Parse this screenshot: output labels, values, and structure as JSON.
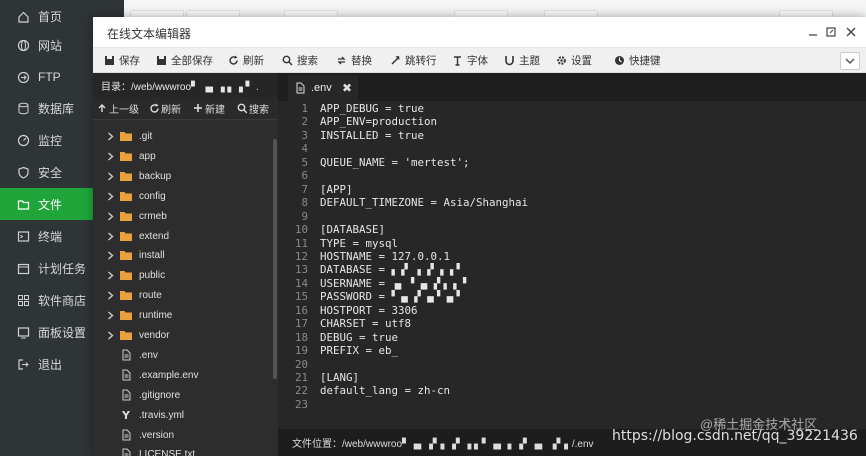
{
  "sidebar": {
    "items": [
      {
        "label": "首页",
        "icon": "home-icon"
      },
      {
        "label": "网站",
        "icon": "globe-icon"
      },
      {
        "label": "FTP",
        "icon": "ftp-icon"
      },
      {
        "label": "数据库",
        "icon": "database-icon"
      },
      {
        "label": "监控",
        "icon": "monitor-icon"
      },
      {
        "label": "安全",
        "icon": "shield-icon"
      },
      {
        "label": "文件",
        "icon": "folder-icon"
      },
      {
        "label": "终端",
        "icon": "terminal-icon"
      },
      {
        "label": "计划任务",
        "icon": "schedule-icon"
      },
      {
        "label": "软件商店",
        "icon": "store-icon"
      },
      {
        "label": "面板设置",
        "icon": "settings-icon"
      },
      {
        "label": "退出",
        "icon": "logout-icon"
      }
    ],
    "active_index": 6,
    "active_color": "#20a53a"
  },
  "window": {
    "title": "在线文本编辑器",
    "controls": [
      "minimize",
      "maximize",
      "close"
    ]
  },
  "toolbar": {
    "items": [
      {
        "label": "保存",
        "icon": "save-icon"
      },
      {
        "label": "全部保存",
        "icon": "save-all-icon"
      },
      {
        "label": "刷新",
        "icon": "refresh-icon"
      },
      {
        "label": "搜索",
        "icon": "search-icon"
      },
      {
        "label": "替换",
        "icon": "replace-icon"
      },
      {
        "label": "跳转行",
        "icon": "goto-line-icon"
      },
      {
        "label": "字体",
        "icon": "font-icon"
      },
      {
        "label": "主题",
        "icon": "theme-icon"
      },
      {
        "label": "设置",
        "icon": "gear-icon"
      },
      {
        "label": "快捷键",
        "icon": "shortcut-icon"
      }
    ]
  },
  "tree": {
    "dir_label": "目录：/web/wwwroo▘ ▗▖▗ ▖▗ ▘ .",
    "actions": [
      {
        "label": "上一级",
        "icon": "arrow-up-icon"
      },
      {
        "label": "刷新",
        "icon": "refresh-icon"
      },
      {
        "label": "新建",
        "icon": "plus-icon"
      },
      {
        "label": "搜索",
        "icon": "search-icon"
      }
    ],
    "folders": [
      ".git",
      "app",
      "backup",
      "config",
      "crmeb",
      "extend",
      "install",
      "public",
      "route",
      "runtime",
      "vendor"
    ],
    "files": [
      {
        "name": ".env",
        "icon": "file-icon"
      },
      {
        "name": ".example.env",
        "icon": "file-icon"
      },
      {
        "name": ".gitignore",
        "icon": "file-icon"
      },
      {
        "name": ".travis.yml",
        "icon": "yaml-icon"
      },
      {
        "name": ".version",
        "icon": "file-icon"
      },
      {
        "name": "LICENSE.txt",
        "icon": "file-icon"
      }
    ]
  },
  "editor": {
    "tab_label": ".env",
    "lines": [
      "APP_DEBUG = true",
      "APP_ENV=production",
      "INSTALLED = true",
      "",
      "QUEUE_NAME = 'mertest';",
      "",
      "[APP]",
      "DEFAULT_TIMEZONE = Asia/Shanghai",
      "",
      "[DATABASE]",
      "TYPE = mysql",
      "HOSTNAME = 127.0.0.1",
      "DATABASE = ▖▗▘ ▖▗▘▗ ▖▘",
      "USERNAME = ▗▖ ▘▗▖▗▘▖▗ ▘",
      "PASSWORD = ▘▗▖▗▘▗▖▘▗▖▘",
      "HOSTPORT = 3306",
      "CHARSET = utf8",
      "DEBUG = true",
      "PREFIX = eb_",
      "",
      "[LANG]",
      "default_lang = zh-cn",
      ""
    ],
    "status_label": "文件位置：/web/wwwroo▘▗▖▗▘▖▗▘▗ ▖▘▗▖ ▖▗▘▗▖ ▗▘▖/.env"
  },
  "watermark": {
    "text": "https://blog.csdn.net/qq_39221436",
    "text2": "@稀土掘金技术社区"
  }
}
